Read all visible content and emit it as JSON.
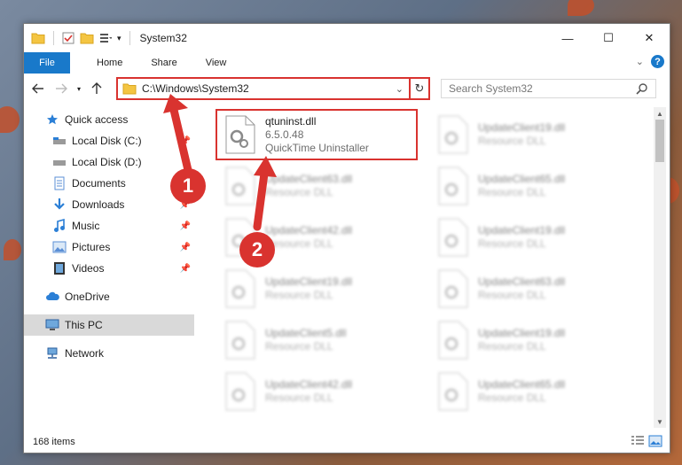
{
  "window": {
    "title": "System32",
    "controls": {
      "minimize": "—",
      "maximize": "☐",
      "close": "✕"
    }
  },
  "ribbon": {
    "file": "File",
    "tabs": [
      "Home",
      "Share",
      "View"
    ],
    "help": "?"
  },
  "nav": {
    "address": "C:\\Windows\\System32",
    "search_placeholder": "Search System32"
  },
  "sidebar": {
    "items": [
      {
        "label": "Quick access",
        "icon": "star-icon",
        "pinned": false
      },
      {
        "label": "Local Disk (C:)",
        "icon": "drive-icon",
        "pinned": true
      },
      {
        "label": "Local Disk (D:)",
        "icon": "drive-icon",
        "pinned": false
      },
      {
        "label": "Documents",
        "icon": "documents-icon",
        "pinned": true
      },
      {
        "label": "Downloads",
        "icon": "download-icon",
        "pinned": true
      },
      {
        "label": "Music",
        "icon": "music-icon",
        "pinned": true
      },
      {
        "label": "Pictures",
        "icon": "pictures-icon",
        "pinned": true
      },
      {
        "label": "Videos",
        "icon": "videos-icon",
        "pinned": true
      },
      {
        "label": "OneDrive",
        "icon": "cloud-icon",
        "pinned": false
      },
      {
        "label": "This PC",
        "icon": "computer-icon",
        "pinned": false,
        "selected": true
      },
      {
        "label": "Network",
        "icon": "network-icon",
        "pinned": false
      }
    ]
  },
  "files": [
    {
      "name": "qtuninst.dll",
      "line2": "6.5.0.48",
      "line3": "QuickTime Uninstaller",
      "highlighted": true
    },
    {
      "name": "UpdateClient19.dll",
      "line2": "Resource DLL"
    },
    {
      "name": "UpdateClient63.dll",
      "line2": "Resource DLL"
    },
    {
      "name": "UpdateClient65.dll",
      "line2": "Resource DLL"
    },
    {
      "name": "UpdateClient42.dll",
      "line2": "Resource DLL"
    },
    {
      "name": "UpdateClient19.dll",
      "line2": "Resource DLL"
    },
    {
      "name": "UpdateClient19.dll",
      "line2": "Resource DLL"
    },
    {
      "name": "UpdateClient63.dll",
      "line2": "Resource DLL"
    },
    {
      "name": "UpdateClient5.dll",
      "line2": "Resource DLL"
    },
    {
      "name": "UpdateClient19.dll",
      "line2": "Resource DLL"
    },
    {
      "name": "UpdateClient42.dll",
      "line2": "Resource DLL"
    },
    {
      "name": "UpdateClient65.dll",
      "line2": "Resource DLL"
    }
  ],
  "status": {
    "item_count": "168 items"
  },
  "annotations": {
    "badge1": "1",
    "badge2": "2"
  },
  "colors": {
    "accent": "#1979ca",
    "highlight": "#d9332f",
    "folder": "#f4c542"
  }
}
